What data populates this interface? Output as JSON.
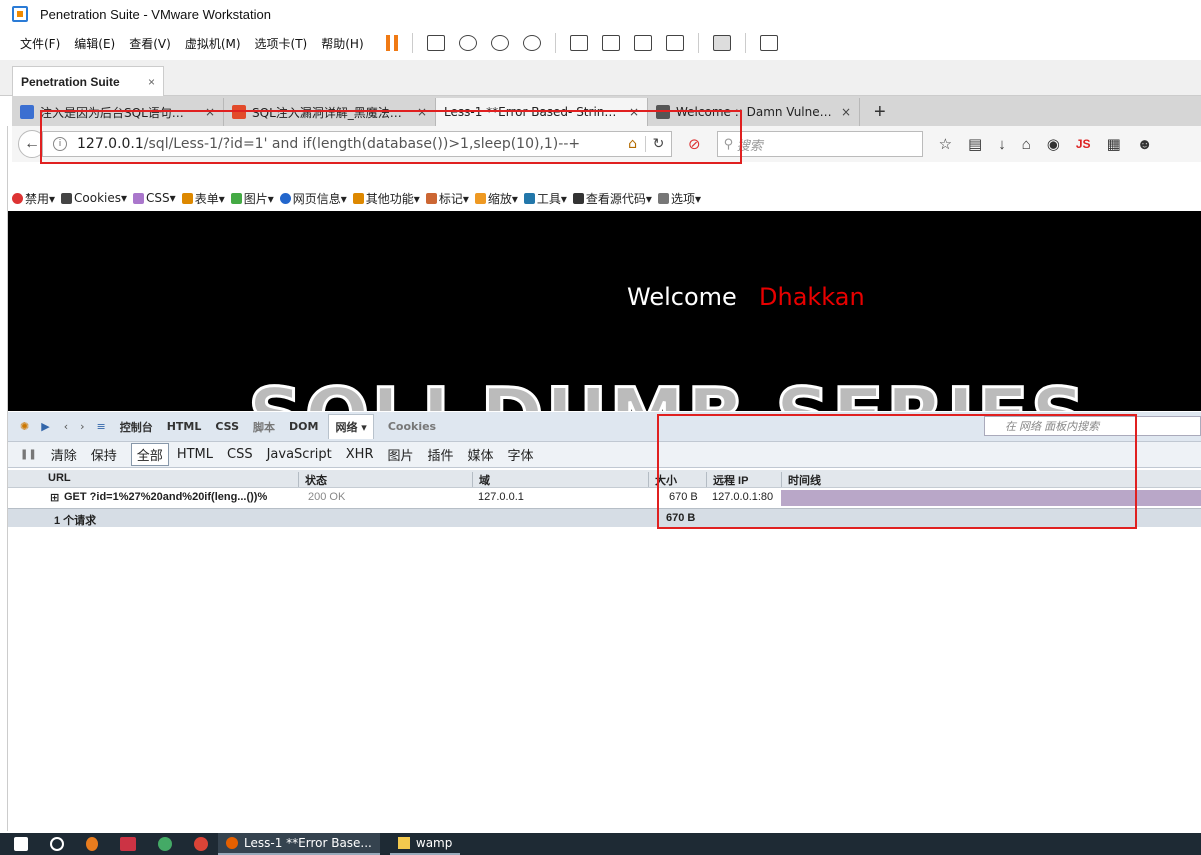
{
  "window": {
    "title": "Penetration Suite - VMware Workstation"
  },
  "menu": [
    "文件(F)",
    "编辑(E)",
    "查看(V)",
    "虚拟机(M)",
    "选项卡(T)",
    "帮助(H)"
  ],
  "vm_tab": {
    "label": "Penetration Suite",
    "close": "×"
  },
  "browser": {
    "tabs": [
      {
        "label": "注入是因为后台SQL语句…",
        "close": "×",
        "color": "#3b6fd1"
      },
      {
        "label": "SQL注入漏洞详解_黑魔法…",
        "close": "×",
        "color": "#e24a2a"
      },
      {
        "label": "Less-1 **Error Based- Strin…",
        "close": "×",
        "color": "#ffffff"
      },
      {
        "label": "Welcome :: Damn Vulne…",
        "close": "×",
        "color": "#555555"
      }
    ],
    "new_tab": "+",
    "url_host": "127.0.0.1",
    "url_path": "/sql/Less-1/?id=1' and if(length(database())>1,sleep(10),1)--+",
    "search_placeholder": "搜索",
    "js_label": "JS"
  },
  "webdev": [
    "禁用▾",
    "Cookies▾",
    "CSS▾",
    "表单▾",
    "图片▾",
    "网页信息▾",
    "其他功能▾",
    "标记▾",
    "缩放▾",
    "工具▾",
    "查看源代码▾",
    "选项▾"
  ],
  "page": {
    "welcome": "Welcome",
    "name": "Dhakkan",
    "banner": "SQLI DUMB SERIES"
  },
  "firebug": {
    "tabs": [
      "控制台",
      "HTML",
      "CSS",
      "脚本",
      "DOM",
      "网络 ▾",
      "Cookies"
    ],
    "search_placeholder": "在 网络 面板内搜索",
    "sub": [
      "清除",
      "保持",
      "全部",
      "HTML",
      "CSS",
      "JavaScript",
      "XHR",
      "图片",
      "插件",
      "媒体",
      "字体"
    ],
    "columns": [
      "URL",
      "状态",
      "域",
      "大小",
      "远程 IP",
      "时间线"
    ],
    "request": {
      "url": "GET ?id=1%27%20and%20if(leng...())%",
      "status": "200 OK",
      "domain": "127.0.0.1",
      "size": "670 B",
      "ip": "127.0.0.1:80"
    },
    "summary": {
      "count": "1 个请求",
      "size": "670 B"
    }
  },
  "taskbar": {
    "firefox_task": "Less-1 **Error Base...",
    "folder_task": "wamp"
  }
}
